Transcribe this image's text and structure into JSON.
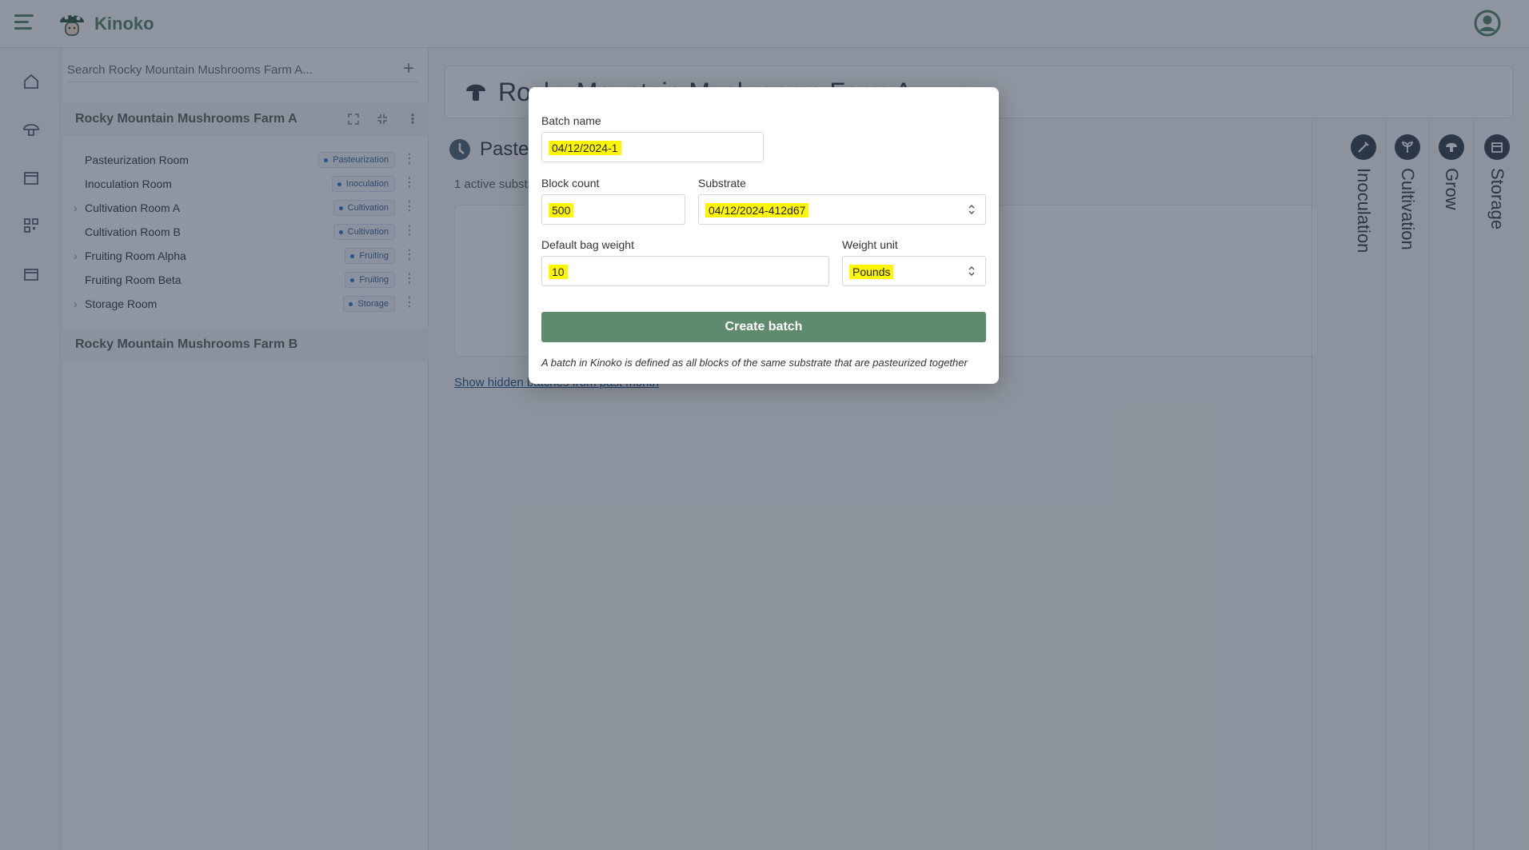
{
  "app": {
    "brand": "Kinoko"
  },
  "sidebar": {
    "search_placeholder": "Search Rocky Mountain Mushrooms Farm A...",
    "farms": [
      {
        "name": "Rocky Mountain Mushrooms Farm A"
      },
      {
        "name": "Rocky Mountain Mushrooms Farm B"
      }
    ],
    "rooms": [
      {
        "name": "Pasteurization Room",
        "tag": "Pasteurization"
      },
      {
        "name": "Inoculation Room",
        "tag": "Inoculation"
      },
      {
        "name": "Cultivation Room A",
        "tag": "Cultivation"
      },
      {
        "name": "Cultivation Room B",
        "tag": "Cultivation"
      },
      {
        "name": "Fruiting Room Alpha",
        "tag": "Fruiting"
      },
      {
        "name": "Fruiting Room Beta",
        "tag": "Fruiting"
      },
      {
        "name": "Storage Room",
        "tag": "Storage"
      }
    ]
  },
  "main": {
    "title": "Rocky Mountain Mushrooms Farm A",
    "section_title": "Pasteurization",
    "subtitle": "1 active substrate",
    "hidden_link": "Show hidden batches from past month"
  },
  "tabs": [
    {
      "label": "Inoculation"
    },
    {
      "label": "Cultivation"
    },
    {
      "label": "Grow"
    },
    {
      "label": "Storage"
    }
  ],
  "modal": {
    "batch_name_label": "Batch name",
    "batch_name_value": "04/12/2024-1",
    "block_count_label": "Block count",
    "block_count_value": "500",
    "substrate_label": "Substrate",
    "substrate_value": "04/12/2024-412d67",
    "bag_weight_label": "Default bag weight",
    "bag_weight_value": "10",
    "weight_unit_label": "Weight unit",
    "weight_unit_value": "Pounds",
    "create_label": "Create batch",
    "note": "A batch in Kinoko is defined as all blocks of the same substrate that are pasteurized together"
  },
  "colors": {
    "accent": "#5e8a6e",
    "highlight": "#fff600",
    "overlay": "#17243a"
  }
}
